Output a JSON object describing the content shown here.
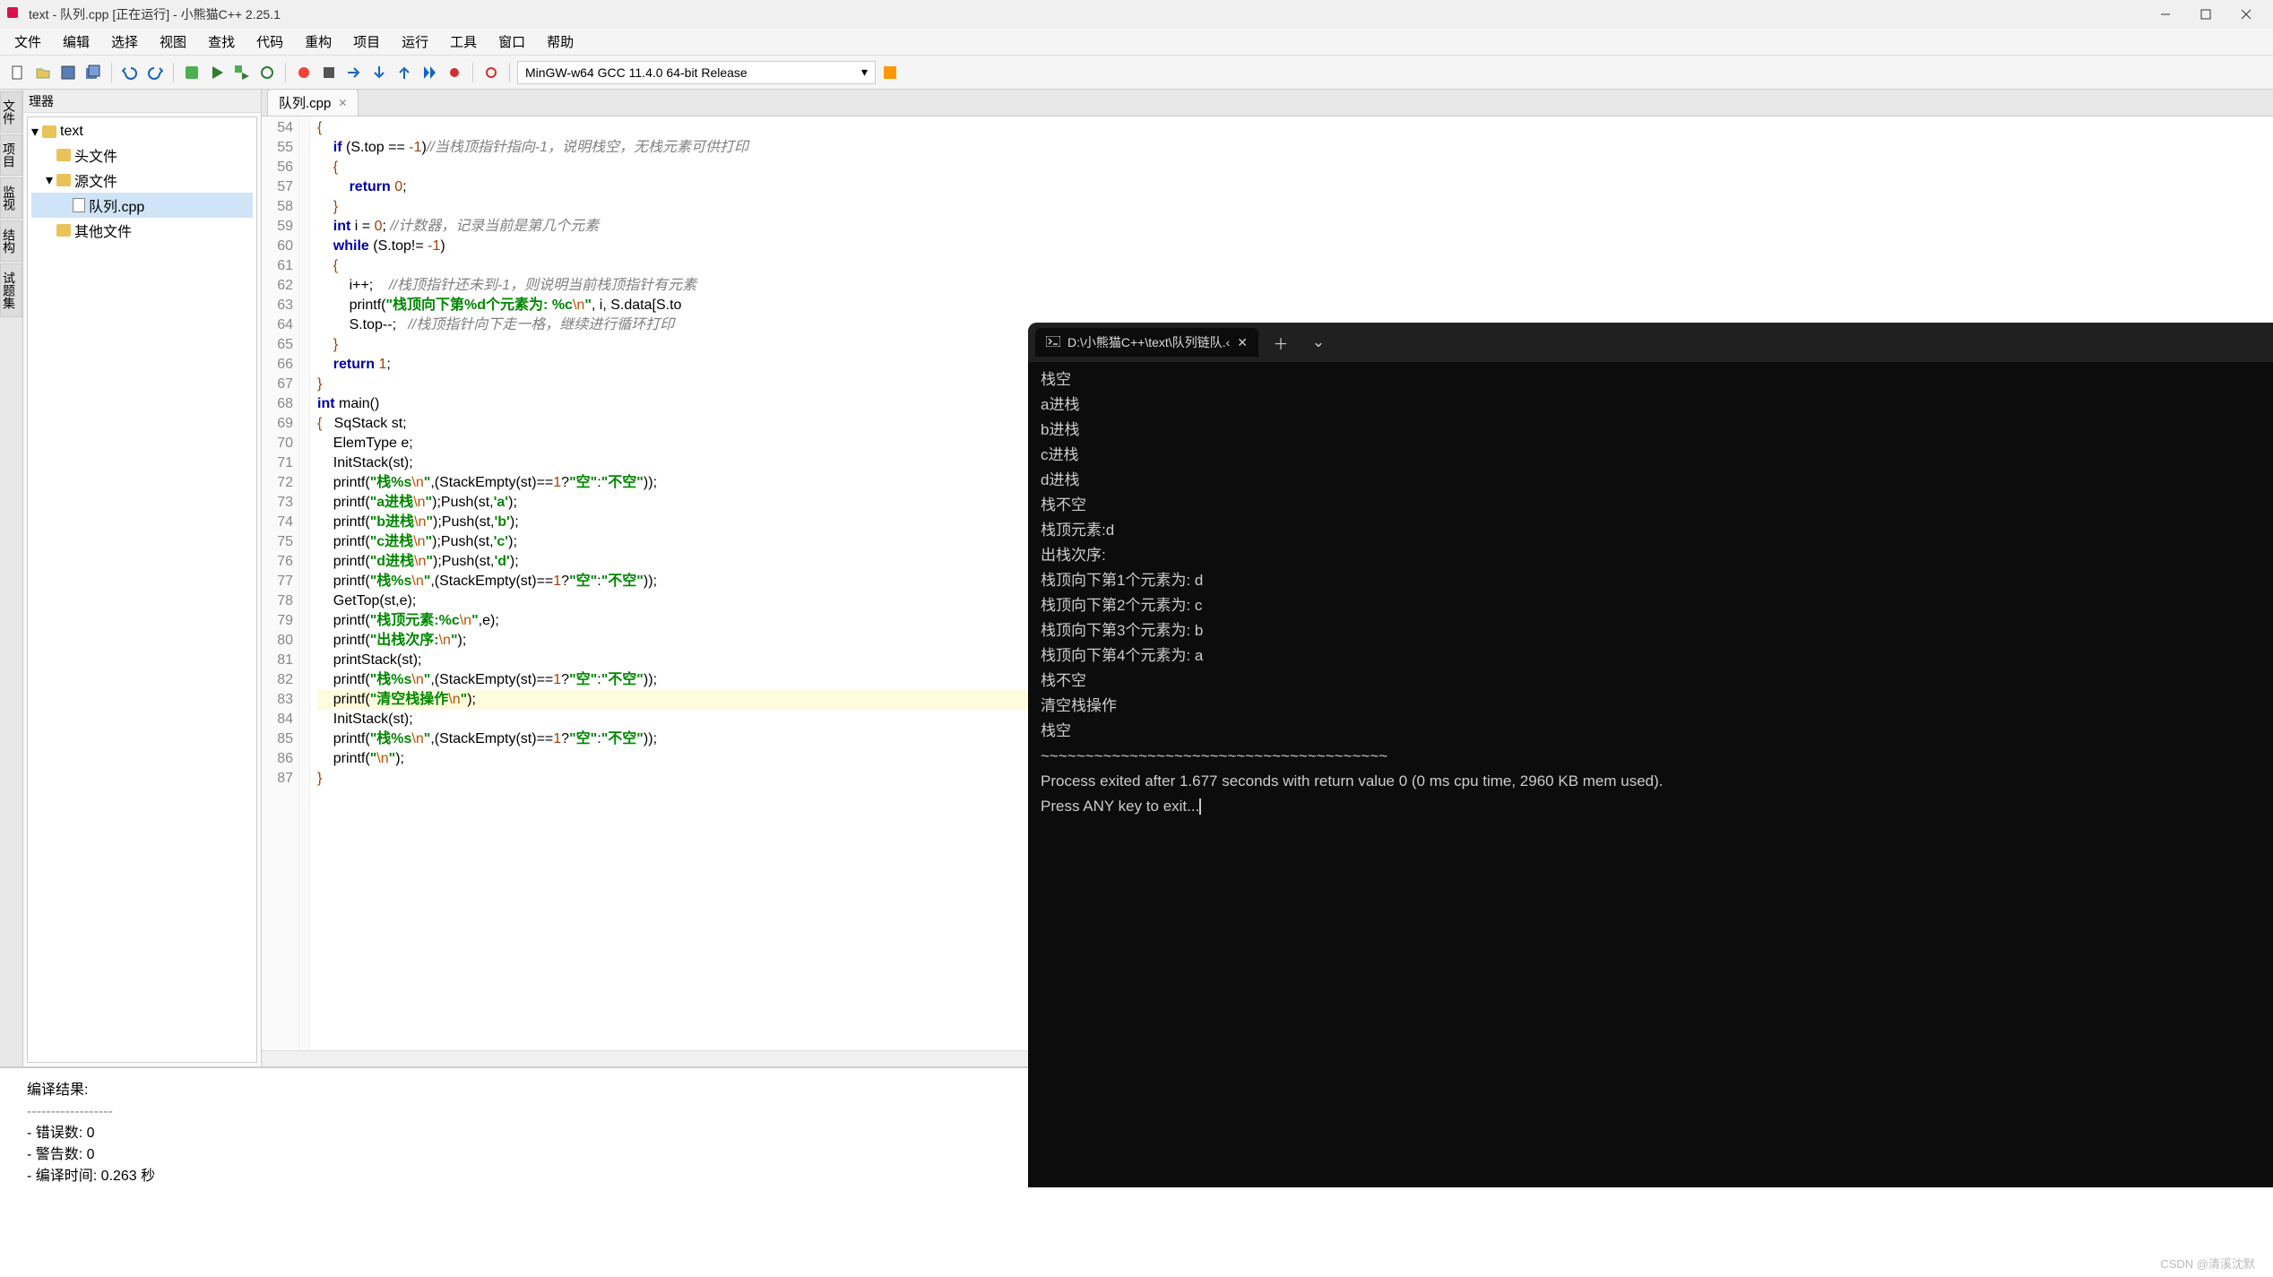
{
  "window": {
    "title": "text - 队列.cpp [正在运行] - 小熊猫C++ 2.25.1"
  },
  "menu": {
    "items": [
      "文件",
      "编辑",
      "选择",
      "视图",
      "查找",
      "代码",
      "重构",
      "项目",
      "运行",
      "工具",
      "窗口",
      "帮助"
    ]
  },
  "toolbar": {
    "compiler": "MinGW-w64 GCC 11.4.0 64-bit Release"
  },
  "side_tabs": [
    "文件",
    "项目",
    "监视",
    "结构",
    "试题集"
  ],
  "project": {
    "panel_title": "理器",
    "root": "text",
    "folders": {
      "headers": "头文件",
      "sources": "源文件",
      "src_file": "队列.cpp",
      "others": "其他文件"
    }
  },
  "tabs": [
    {
      "label": "队列.cpp",
      "active": true
    }
  ],
  "code": {
    "first_line": 54,
    "highlight_line": 83,
    "lines": [
      {
        "n": 54,
        "html": "<span class='op'>{</span>"
      },
      {
        "n": 55,
        "html": "    <span class='kw'>if</span> (S.top == <span class='num'>-1</span>)<span class='com'>//当栈顶指针指向-1，说明栈空，无栈元素可供打印</span>"
      },
      {
        "n": 56,
        "html": "    <span class='op'>{</span>"
      },
      {
        "n": 57,
        "html": "        <span class='kw'>return</span> <span class='num'>0</span>;"
      },
      {
        "n": 58,
        "html": "    <span class='op'>}</span>"
      },
      {
        "n": 59,
        "html": "    <span class='kw'>int</span> i = <span class='num'>0</span>; <span class='com'>//计数器，记录当前是第几个元素</span>"
      },
      {
        "n": 60,
        "html": "    <span class='kw'>while</span> (S.top!= <span class='num'>-1</span>)"
      },
      {
        "n": 61,
        "html": "    <span class='op'>{</span>"
      },
      {
        "n": 62,
        "html": "        i++;    <span class='com'>//栈顶指针还未到-1，则说明当前栈顶指针有元素</span>"
      },
      {
        "n": 63,
        "html": "        printf(<span class='str'>\"栈顶向下第%d个元素为: %c</span><span class='esc'>\\n</span><span class='str'>\"</span>, i, S.data[S.to"
      },
      {
        "n": 64,
        "html": "        S.top--;   <span class='com'>//栈顶指针向下走一格，继续进行循环打印</span>"
      },
      {
        "n": 65,
        "html": "    <span class='op'>}</span>"
      },
      {
        "n": 66,
        "html": "    <span class='kw'>return</span> <span class='num'>1</span>;"
      },
      {
        "n": 67,
        "html": "<span class='op'>}</span>"
      },
      {
        "n": 68,
        "html": "<span class='kw'>int</span> main()"
      },
      {
        "n": 69,
        "html": "<span class='op'>{</span>   SqStack st;"
      },
      {
        "n": 70,
        "html": "    ElemType e;"
      },
      {
        "n": 71,
        "html": "    InitStack(st);"
      },
      {
        "n": 72,
        "html": "    printf(<span class='str'>\"栈%s</span><span class='esc'>\\n</span><span class='str'>\"</span>,(StackEmpty(st)==<span class='num'>1</span>?<span class='str'>\"空\"</span>:<span class='str'>\"不空\"</span>));"
      },
      {
        "n": 73,
        "html": "    printf(<span class='str'>\"a进栈</span><span class='esc'>\\n</span><span class='str'>\"</span>);Push(st,<span class='str'>'a'</span>);"
      },
      {
        "n": 74,
        "html": "    printf(<span class='str'>\"b进栈</span><span class='esc'>\\n</span><span class='str'>\"</span>);Push(st,<span class='str'>'b'</span>);"
      },
      {
        "n": 75,
        "html": "    printf(<span class='str'>\"c进栈</span><span class='esc'>\\n</span><span class='str'>\"</span>);Push(st,<span class='str'>'c'</span>);"
      },
      {
        "n": 76,
        "html": "    printf(<span class='str'>\"d进栈</span><span class='esc'>\\n</span><span class='str'>\"</span>);Push(st,<span class='str'>'d'</span>);"
      },
      {
        "n": 77,
        "html": "    printf(<span class='str'>\"栈%s</span><span class='esc'>\\n</span><span class='str'>\"</span>,(StackEmpty(st)==<span class='num'>1</span>?<span class='str'>\"空\"</span>:<span class='str'>\"不空\"</span>));"
      },
      {
        "n": 78,
        "html": "    GetTop(st,e);"
      },
      {
        "n": 79,
        "html": "    printf(<span class='str'>\"栈顶元素:%c</span><span class='esc'>\\n</span><span class='str'>\"</span>,e);"
      },
      {
        "n": 80,
        "html": "    printf(<span class='str'>\"出栈次序:</span><span class='esc'>\\n</span><span class='str'>\"</span>);"
      },
      {
        "n": 81,
        "html": "    printStack(st);"
      },
      {
        "n": 82,
        "html": "    printf(<span class='str'>\"栈%s</span><span class='esc'>\\n</span><span class='str'>\"</span>,(StackEmpty(st)==<span class='num'>1</span>?<span class='str'>\"空\"</span>:<span class='str'>\"不空\"</span>));"
      },
      {
        "n": 83,
        "html": "    printf(<span class='str'>\"清空栈操作</span><span class='esc'>\\n</span><span class='str'>\"</span>);"
      },
      {
        "n": 84,
        "html": "    InitStack(st);"
      },
      {
        "n": 85,
        "html": "    printf(<span class='str'>\"栈%s</span><span class='esc'>\\n</span><span class='str'>\"</span>,(StackEmpty(st)==<span class='num'>1</span>?<span class='str'>\"空\"</span>:<span class='str'>\"不空\"</span>));"
      },
      {
        "n": 86,
        "html": "    printf(<span class='str'>\"</span><span class='esc'>\\n</span><span class='str'>\"</span>);"
      },
      {
        "n": 87,
        "html": "<span class='op'>}</span>"
      }
    ]
  },
  "output": {
    "title": "编译结果:",
    "dashes": "------------------",
    "lines": [
      "- 错误数: 0",
      "- 警告数: 0",
      "- 编译时间: 0.263 秒"
    ]
  },
  "console": {
    "tab_title": "D:\\小熊猫C++\\text\\队列链队.‹",
    "lines": [
      "栈空",
      "a进栈",
      "b进栈",
      "c进栈",
      "d进栈",
      "栈不空",
      "栈顶元素:d",
      "出栈次序:",
      "栈顶向下第1个元素为: d",
      "栈顶向下第2个元素为: c",
      "栈顶向下第3个元素为: b",
      "栈顶向下第4个元素为: a",
      "栈不空",
      "清空栈操作",
      "栈空",
      "",
      "~~~~~~~~~~~~~~~~~~~~~~~~~~~~~~~~~~~~~~~",
      "Process exited after 1.677 seconds with return value 0 (0 ms cpu time, 2960 KB mem used).",
      "",
      "Press ANY key to exit..."
    ]
  },
  "watermark": "CSDN @清溪沈默"
}
